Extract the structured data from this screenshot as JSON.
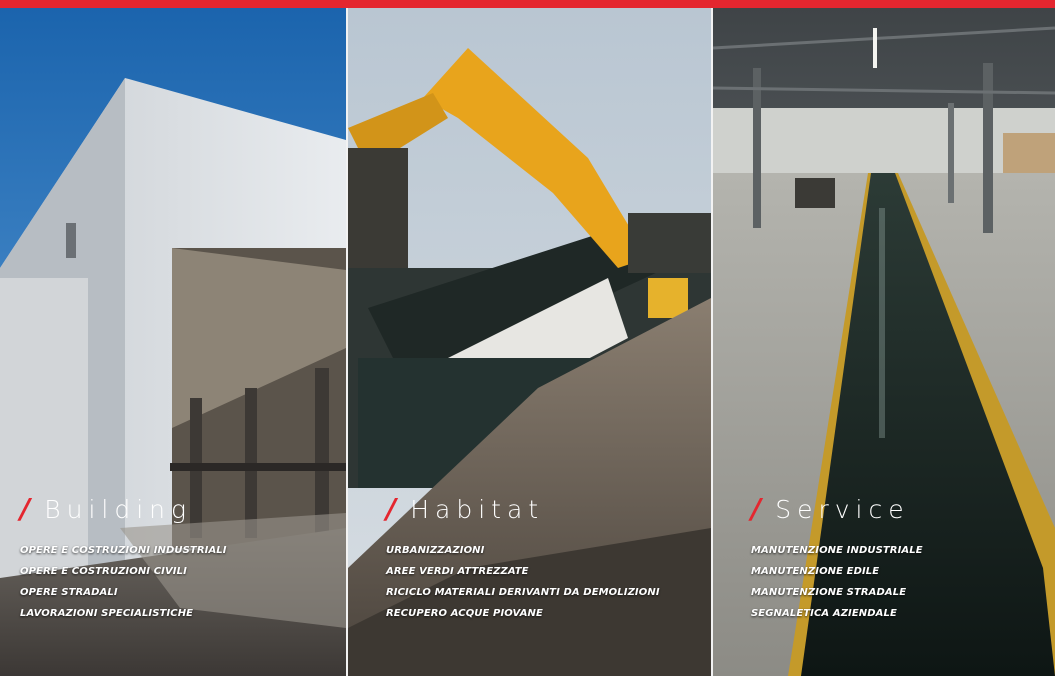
{
  "colors": {
    "accent": "#e4262f",
    "text": "#ffffff",
    "divider": "#f2f2f2"
  },
  "panels": [
    {
      "slash": "/",
      "title": "Building",
      "items": [
        "OPERE E COSTRUZIONI INDUSTRIALI",
        "OPERE E COSTRUZIONI CIVILI",
        "OPERE STRADALI",
        "LAVORAZIONI SPECIALISTICHE"
      ]
    },
    {
      "slash": "/",
      "title": "Habitat",
      "items": [
        "URBANIZZAZIONI",
        "AREE VERDI ATTREZZATE",
        "RICICLO MATERIALI DERIVANTI DA DEMOLIZIONI",
        "RECUPERO ACQUE PIOVANE"
      ]
    },
    {
      "slash": "/",
      "title": "Service",
      "items": [
        "MANUTENZIONE INDUSTRIALE",
        "MANUTENZIONE EDILE",
        "MANUTENZIONE STRADALE",
        "SEGNALETICA AZIENDALE"
      ]
    }
  ]
}
